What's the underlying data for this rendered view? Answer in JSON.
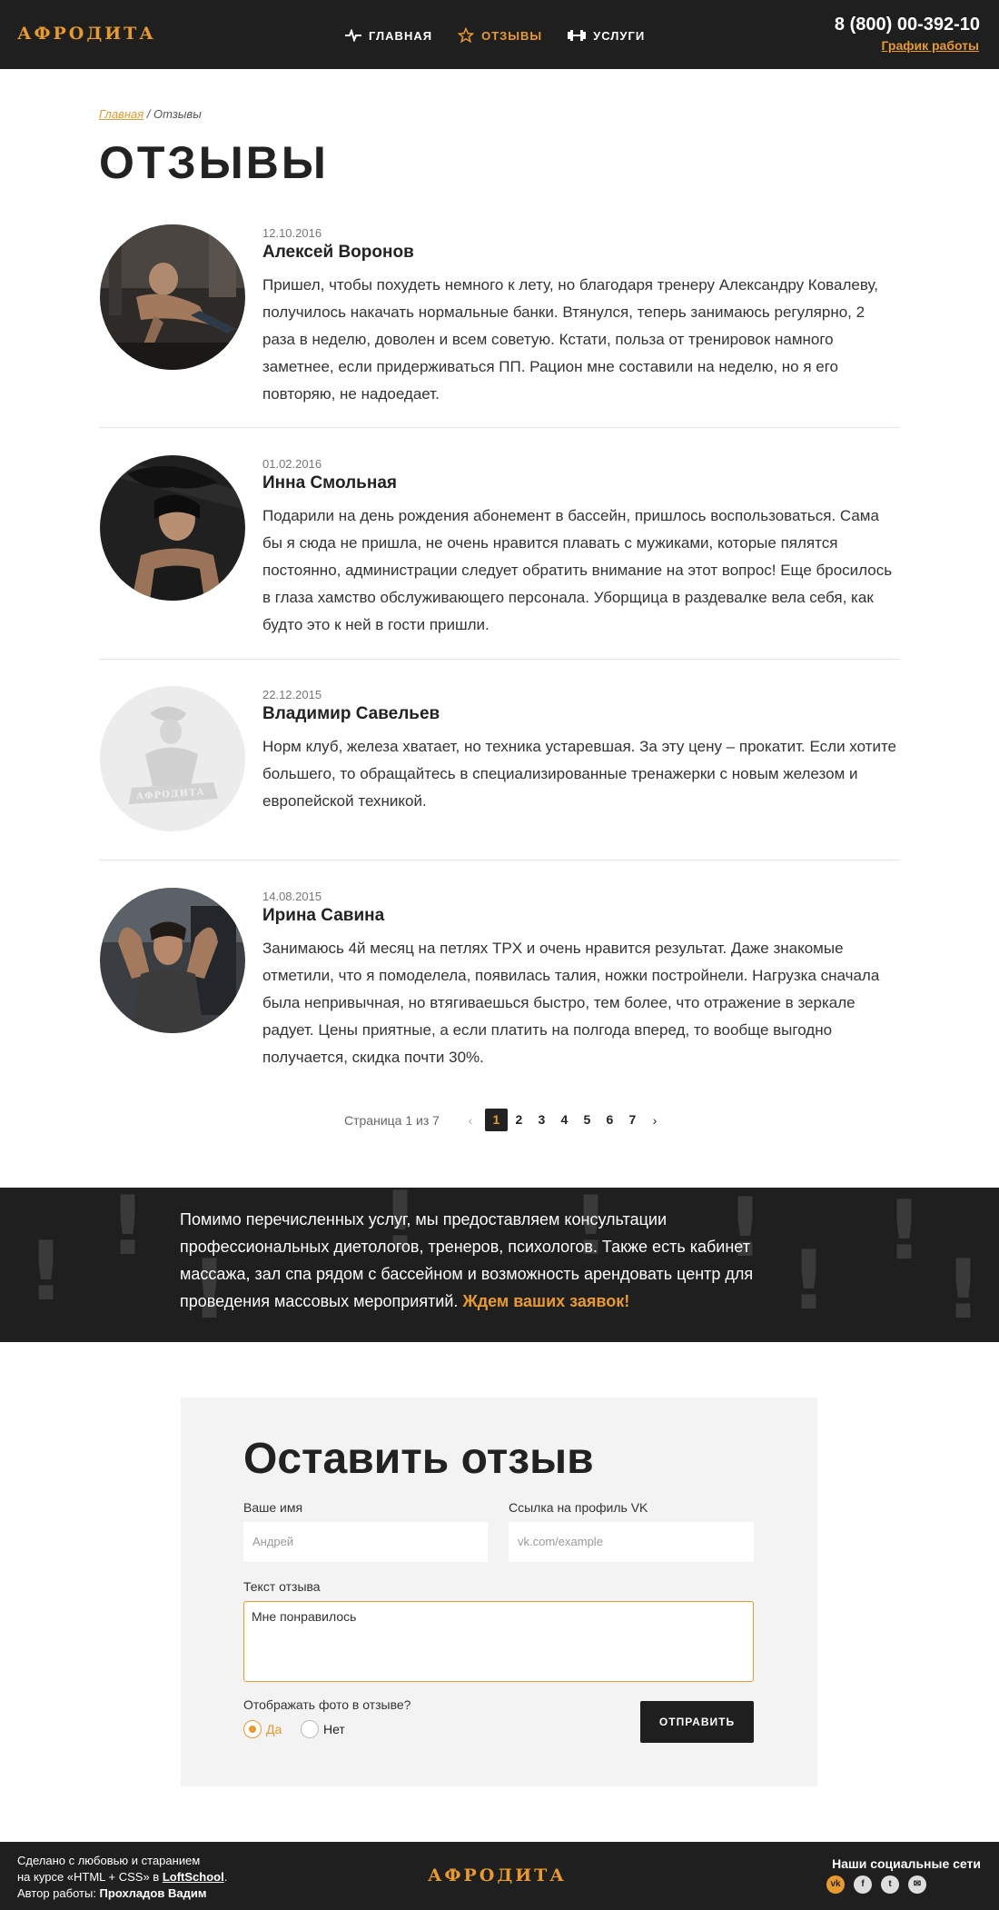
{
  "header": {
    "logo": "АФРОДИТА",
    "nav": [
      {
        "label": "ГЛАВНАЯ",
        "icon": "pulse-icon"
      },
      {
        "label": "ОТЗЫВЫ",
        "icon": "star-icon"
      },
      {
        "label": "УСЛУГИ",
        "icon": "dumbbell-icon"
      }
    ],
    "phone": "8 (800) 00-392-10",
    "schedule": "График работы"
  },
  "breadcrumb": {
    "home": "Главная",
    "sep": " / ",
    "current": "Отзывы"
  },
  "page_title": "ОТЗЫВЫ",
  "reviews": [
    {
      "date": "12.10.2016",
      "name": "Алексей Воронов",
      "text": "Пришел, чтобы похудеть немного к лету, но благодаря тренеру Александру Ковалеву, получилось накачать нормальные банки. Втянулся, теперь занимаюсь регулярно, 2 раза в неделю, доволен и всем советую. Кстати, польза от тренировок намного заметнее, если придерживаться ПП. Рацион мне составили на неделю, но я его повторяю, не надоедает."
    },
    {
      "date": "01.02.2016",
      "name": "Инна Смольная",
      "text": "Подарили на день рождения абонемент в бассейн, пришлось воспользоваться. Сама бы я сюда не пришла, не очень нравится плавать с мужиками, которые пялятся постоянно, администрации следует обратить внимание на этот вопрос! Еще бросилось в глаза хамство обслуживающего персонала. Уборщица в раздевалке вела себя, как будто это к ней в гости пришли."
    },
    {
      "date": "22.12.2015",
      "name": "Владимир Савельев",
      "text": "Норм клуб, железа хватает, но техника устаревшая. За эту цену – прокатит. Если хотите большего, то обращайтесь в специализированные тренажерки с новым железом и европейской техникой."
    },
    {
      "date": "14.08.2015",
      "name": "Ирина Савина",
      "text": "Занимаюсь 4й месяц на петлях TPX и очень нравится результат. Даже знакомые отметили, что я помоделела, появилась талия, ножки постройнели. Нагрузка сначала была непривычная, но втягиваешься быстро, тем более, что отражение в зеркале радует. Цены приятные, а если платить на полгода вперед, то вообще выгодно получается, скидка почти 30%."
    }
  ],
  "placeholder_avatar_label": "АФРОДИТА",
  "pagination": {
    "label": "Страница 1 из 7",
    "pages": [
      "1",
      "2",
      "3",
      "4",
      "5",
      "6",
      "7"
    ],
    "prev": "‹",
    "next": "›"
  },
  "band": {
    "text": "Помимо перечисленных услуг, мы предоставляем консультации профессиональных диетологов, тренеров, психологов. Также есть кабинет массажа, зал спа рядом с бассейном и возможность арендовать центр для проведения массовых мероприятий. ",
    "highlight": "Ждем ваших заявок!"
  },
  "form": {
    "title": "Оставить отзыв",
    "name_label": "Ваше имя",
    "name_placeholder": "Андрей",
    "vk_label": "Ссылка на профиль VK",
    "vk_placeholder": "vk.com/example",
    "text_label": "Текст отзыва",
    "text_value": "Мне понравилось",
    "photo_question": "Отображать фото в отзыве?",
    "radio_yes": "Да",
    "radio_no": "Нет",
    "submit": "ОТПРАВИТЬ"
  },
  "footer": {
    "line1": "Сделано с любовью и старанием",
    "line2_prefix": "на курсе «HTML + CSS» в ",
    "line2_link": "LoftSchool",
    "line2_suffix": ".",
    "line3_prefix": "Автор работы: ",
    "author": "Прохладов Вадим",
    "logo": "АФРОДИТА",
    "social_title": "Наши социальные сети",
    "social": [
      "vk-icon",
      "facebook-icon",
      "twitter-icon",
      "mail-icon"
    ]
  },
  "colors": {
    "accent": "#e89a2e",
    "dark": "#1f1f1f"
  }
}
